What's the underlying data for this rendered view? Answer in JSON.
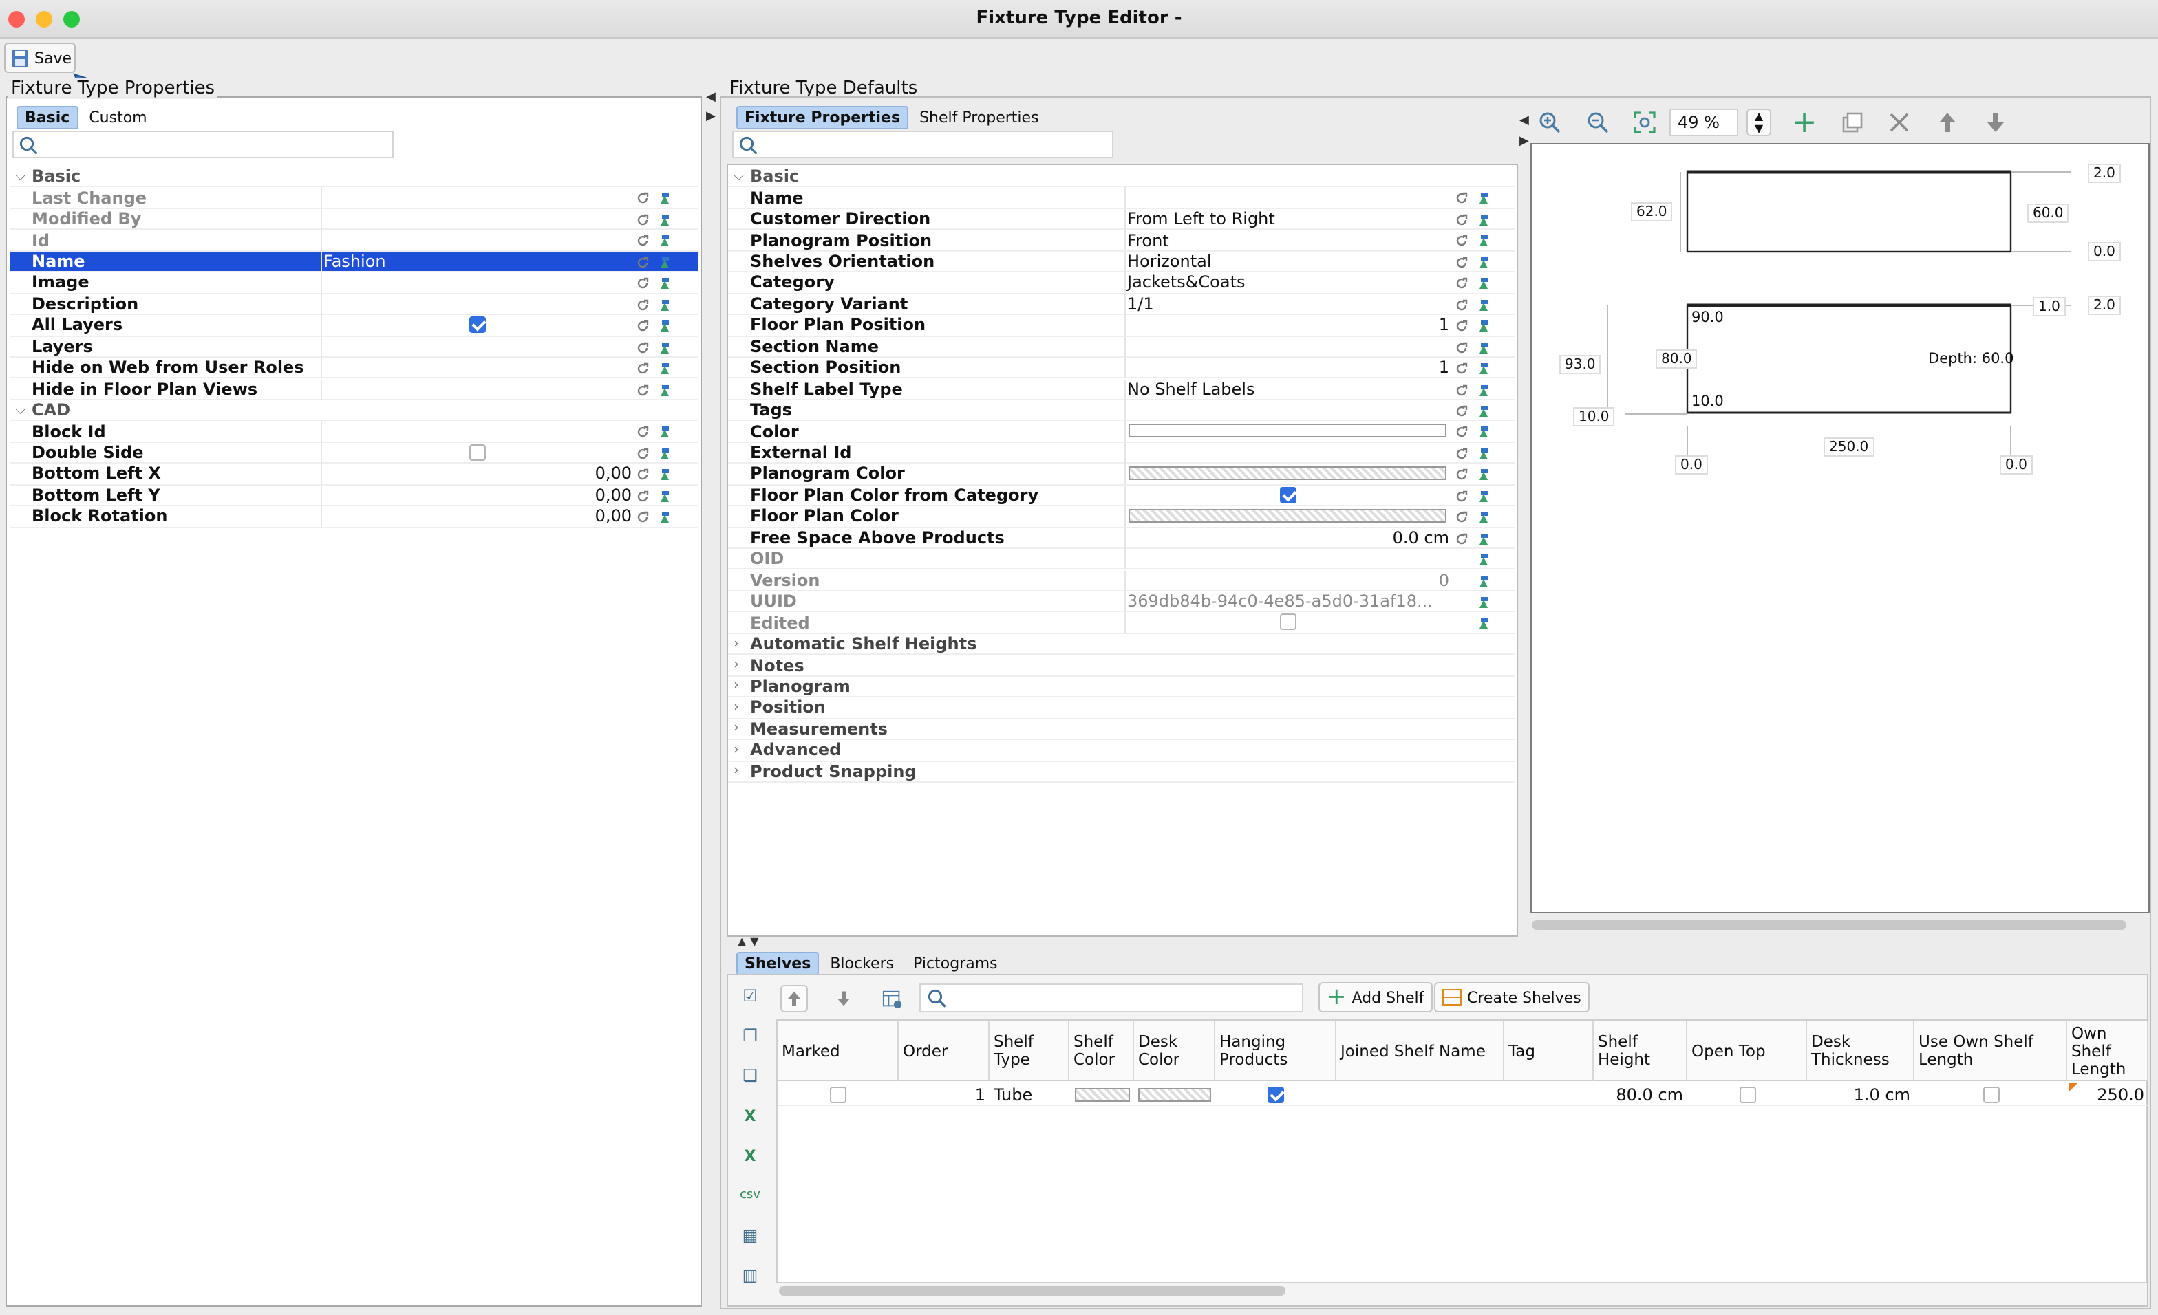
{
  "window": {
    "title": "Fixture Type Editor -"
  },
  "toolbar": {
    "save_label": "Save"
  },
  "left": {
    "group_title": "Fixture Type Properties",
    "tabs": [
      {
        "label": "Basic",
        "selected": true
      },
      {
        "label": "Custom",
        "selected": false
      }
    ],
    "rows": [
      {
        "type": "section",
        "label": "Basic"
      },
      {
        "label": "Last Change",
        "value": "",
        "grey": true
      },
      {
        "label": "Modified By",
        "value": "",
        "grey": true
      },
      {
        "label": "Id",
        "value": "",
        "grey": true
      },
      {
        "label": "Name",
        "value": "Fashion",
        "selected": true
      },
      {
        "label": "Image",
        "value": ""
      },
      {
        "label": "Description",
        "value": ""
      },
      {
        "label": "All Layers",
        "checkbox": true,
        "checked": true
      },
      {
        "label": "Layers",
        "value": ""
      },
      {
        "label": "Hide on Web from User Roles",
        "value": ""
      },
      {
        "label": "Hide in Floor Plan Views",
        "value": ""
      },
      {
        "type": "section",
        "label": "CAD"
      },
      {
        "label": "Block Id",
        "value": ""
      },
      {
        "label": "Double Side",
        "checkbox": true,
        "checked": false
      },
      {
        "label": "Bottom Left X",
        "value": "0,00",
        "right": true
      },
      {
        "label": "Bottom Left Y",
        "value": "0,00",
        "right": true
      },
      {
        "label": "Block Rotation",
        "value": "0,00",
        "right": true
      }
    ]
  },
  "middle": {
    "group_title": "Fixture Type Defaults",
    "tabs": [
      {
        "label": "Fixture Properties",
        "selected": true
      },
      {
        "label": "Shelf Properties",
        "selected": false
      }
    ],
    "rows": [
      {
        "type": "section",
        "label": "Basic"
      },
      {
        "label": "Name",
        "value": ""
      },
      {
        "label": "Customer Direction",
        "value": "From Left to Right"
      },
      {
        "label": "Planogram Position",
        "value": "Front"
      },
      {
        "label": "Shelves Orientation",
        "value": "Horizontal"
      },
      {
        "label": "Category",
        "value": "Jackets&Coats"
      },
      {
        "label": "Category Variant",
        "value": "1/1"
      },
      {
        "label": "Floor Plan Position",
        "value": "1",
        "right": true
      },
      {
        "label": "Section Name",
        "value": ""
      },
      {
        "label": "Section Position",
        "value": "1",
        "right": true
      },
      {
        "label": "Shelf Label Type",
        "value": "No Shelf Labels"
      },
      {
        "label": "Tags",
        "value": ""
      },
      {
        "label": "Color",
        "value": "",
        "swatch": "white"
      },
      {
        "label": "External Id",
        "value": ""
      },
      {
        "label": "Planogram Color",
        "value": "",
        "swatch": "pattern"
      },
      {
        "label": "Floor Plan Color from Category",
        "checkbox": true,
        "checked": true
      },
      {
        "label": "Floor Plan Color",
        "value": "",
        "swatch": "pattern"
      },
      {
        "label": "Free Space Above Products",
        "value": "0.0 cm",
        "right": true
      },
      {
        "label": "OID",
        "value": "",
        "grey": true,
        "noreset": true
      },
      {
        "label": "Version",
        "value": "0",
        "right": true,
        "grey": true,
        "noreset": true
      },
      {
        "label": "UUID",
        "value": "369db84b-94c0-4e85-a5d0-31af18...",
        "grey": true,
        "noreset": true
      },
      {
        "label": "Edited",
        "checkbox": true,
        "checked": false,
        "grey": true,
        "noreset": true
      },
      {
        "type": "collapsed",
        "label": "Automatic Shelf Heights"
      },
      {
        "type": "collapsed",
        "label": "Notes"
      },
      {
        "type": "collapsed",
        "label": "Planogram"
      },
      {
        "type": "collapsed",
        "label": "Position"
      },
      {
        "type": "collapsed",
        "label": "Measurements"
      },
      {
        "type": "collapsed",
        "label": "Advanced"
      },
      {
        "type": "collapsed",
        "label": "Product Snapping"
      }
    ]
  },
  "preview": {
    "zoom": "49 %",
    "dims": {
      "top_right_a": "2.0",
      "left_a": "62.0",
      "right_a": "60.0",
      "bottom_right_a": "0.0",
      "right_b1": "1.0",
      "right_b2": "2.0",
      "inner_top": "90.0",
      "depth": "Depth: 60.0",
      "left_b1": "93.0",
      "left_b2": "80.0",
      "inner_bottom": "10.0",
      "left_b3": "10.0",
      "width": "250.0",
      "bottom_left": "0.0",
      "bottom_right": "0.0"
    }
  },
  "bottom": {
    "tabs": [
      {
        "label": "Shelves",
        "selected": true
      },
      {
        "label": "Blockers",
        "selected": false
      },
      {
        "label": "Pictograms",
        "selected": false
      }
    ],
    "add_shelf": "Add Shelf",
    "create_shelves": "Create Shelves",
    "columns": [
      "Marked",
      "Order",
      "Shelf Type",
      "Shelf Color",
      "Desk Color",
      "Hanging Products",
      "Joined Shelf Name",
      "Tag",
      "Shelf Height",
      "Open Top",
      "Desk Thickness",
      "Use Own Shelf Length",
      "Own Shelf Length"
    ],
    "row": {
      "marked": false,
      "order": "1",
      "shelf_type": "Tube",
      "hanging": true,
      "joined": "",
      "tag": "",
      "height": "80.0 cm",
      "open_top": false,
      "thickness": "1.0 cm",
      "use_own": false,
      "own_length": "250.0"
    }
  },
  "colors": {
    "selection": "#1d4fd8",
    "tab_selected": "#b9d3f3",
    "check": "#2f6fe0",
    "close": "#ff5f57",
    "minimize": "#febc2e",
    "maximize": "#28c840"
  }
}
